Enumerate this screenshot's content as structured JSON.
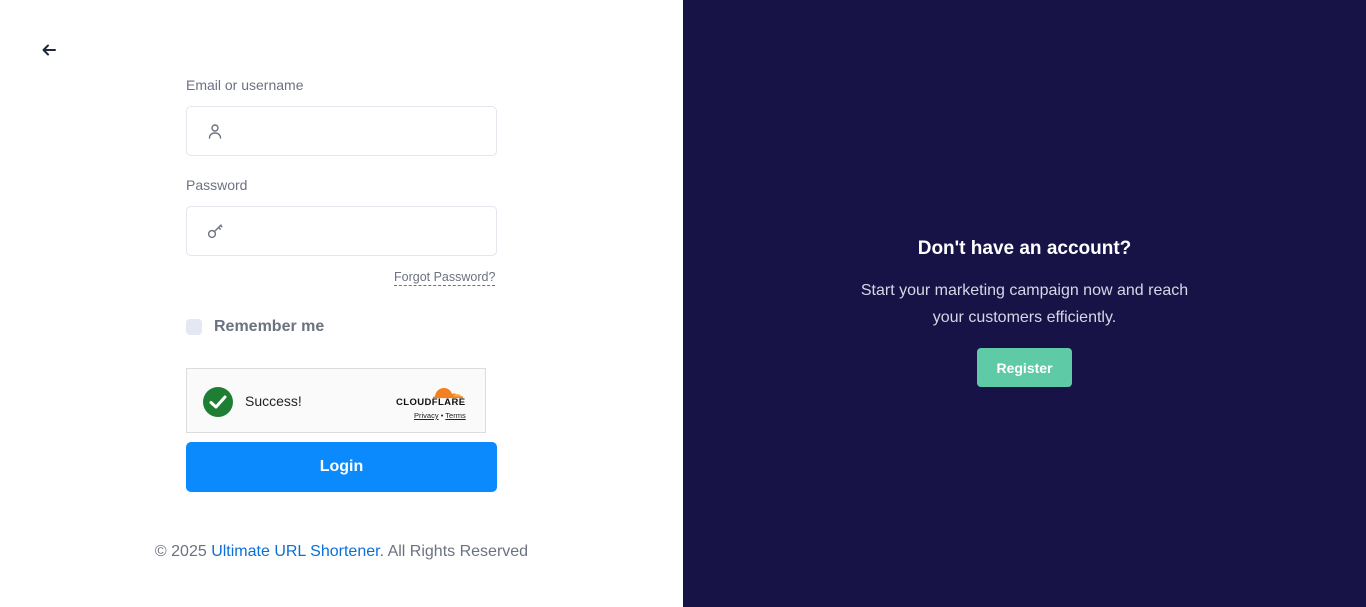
{
  "login": {
    "email_label": "Email or username",
    "email_value": "",
    "password_label": "Password",
    "password_value": "",
    "forgot_label": "Forgot Password?",
    "remember_label": "Remember me",
    "remember_checked": false,
    "login_button": "Login"
  },
  "captcha": {
    "status": "Success!",
    "brand": "CLOUDFLARE",
    "privacy": "Privacy",
    "separator": "•",
    "terms": "Terms",
    "brand_color": "#f38020"
  },
  "footer": {
    "prefix": "© 2025 ",
    "link": "Ultimate URL Shortener",
    "suffix": ". All Rights Reserved"
  },
  "signup_panel": {
    "title": "Don't have an account?",
    "text": "Start your marketing campaign now and reach your customers efficiently.",
    "register_button": "Register"
  },
  "colors": {
    "panel_bg": "#181346",
    "primary": "#0a8afc",
    "register": "#5fcba6"
  },
  "icons": {
    "back": "arrow-left-icon",
    "email": "user-icon",
    "password": "key-icon",
    "captcha_status": "check-circle-icon",
    "captcha_brand": "cloudflare-logo"
  }
}
